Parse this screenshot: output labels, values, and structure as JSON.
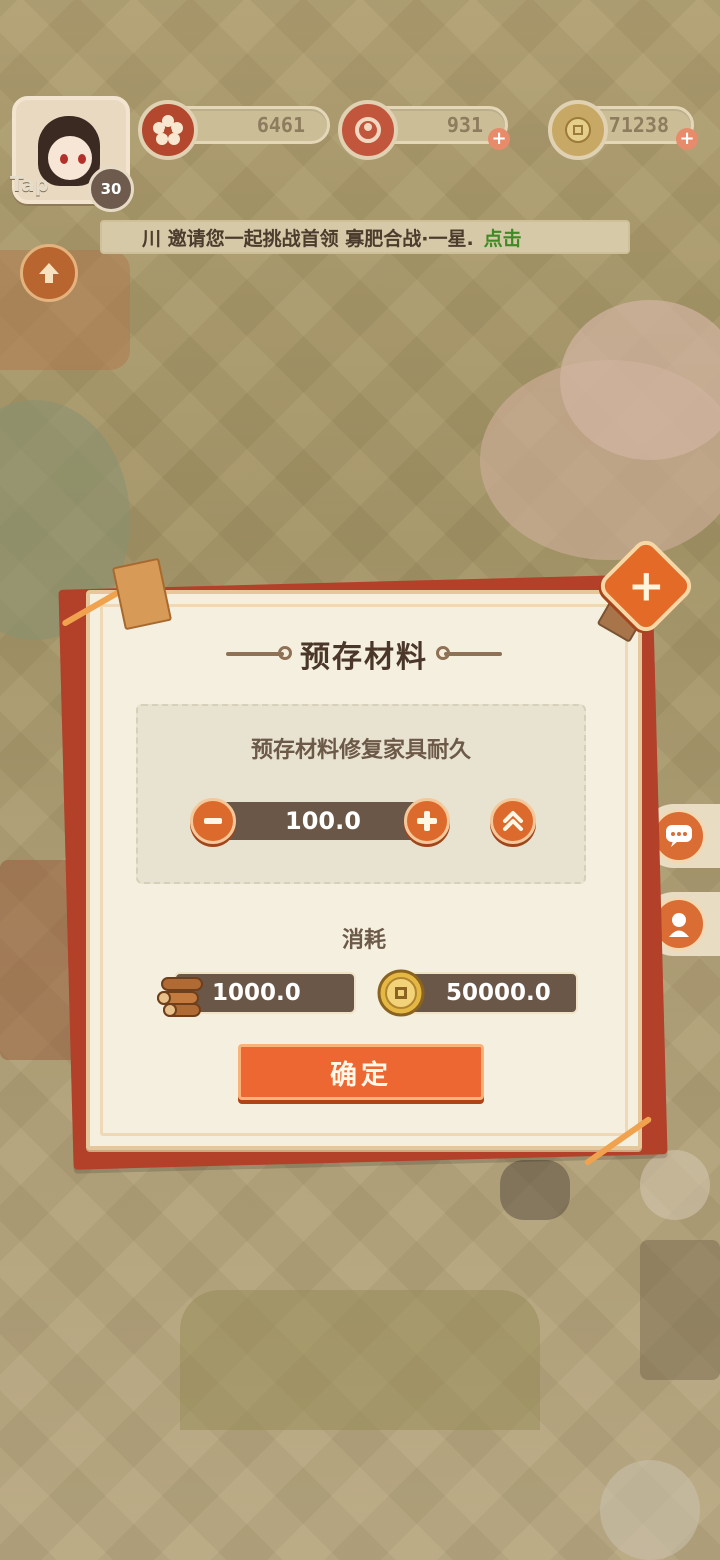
{
  "hud": {
    "avatar_tag": "Tap",
    "level": "30",
    "flower_amount": "6461",
    "gem_amount": "931",
    "coin_amount": "71238",
    "marquee_text": "川 邀请您一起挑战首领 寡肥合战·一星.",
    "marquee_link": "点击"
  },
  "dialog": {
    "title": "预存材料",
    "description": "预存材料修复家具耐久",
    "quantity": "100.0",
    "consume_label": "消耗",
    "wood_cost": "1000.0",
    "coin_cost": "50000.0",
    "confirm_label": "确定"
  },
  "colors": {
    "accent_orange": "#ec6731",
    "dialog_red": "#b34028",
    "paper": "#f4efdf",
    "dark_bar": "#6b5748"
  },
  "icons": [
    "flower-icon",
    "gem-icon",
    "coin-icon",
    "up-arrow-icon",
    "close-icon",
    "minus-icon",
    "plus-icon",
    "max-icon",
    "wood-icon",
    "chat-icon",
    "character-icon"
  ]
}
